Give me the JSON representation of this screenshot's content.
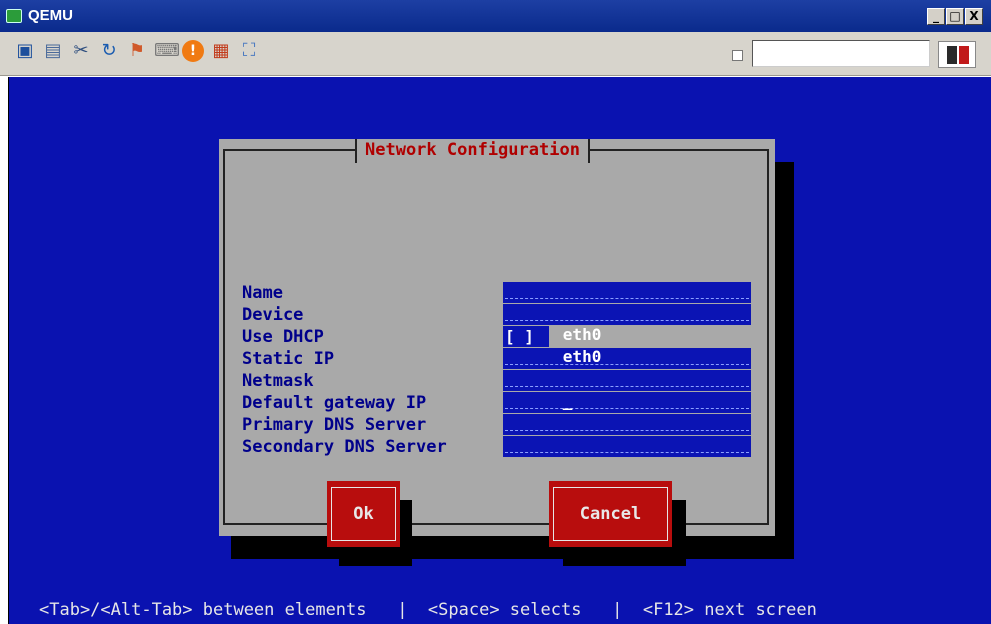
{
  "window": {
    "title": "QEMU",
    "controls": [
      "_",
      "□",
      "X"
    ]
  },
  "toolbar": {
    "icons": [
      "monitor-icon",
      "window-icon",
      "tools-icon",
      "refresh-icon",
      "windows-flag-icon",
      "keyboard-icon",
      "alert-icon",
      "network-icon",
      "fullscreen-icon"
    ],
    "input_value": "",
    "flag_colors": [
      "#2a2a2a",
      "#c11a1a"
    ]
  },
  "dialog": {
    "title": "Network Configuration",
    "fields": [
      {
        "label": "Name",
        "value": "eth0"
      },
      {
        "label": "Device",
        "value": "eth0"
      },
      {
        "label": "Use DHCP",
        "value": "[ ]"
      },
      {
        "label": "Static IP",
        "value": "_"
      },
      {
        "label": "Netmask",
        "value": ""
      },
      {
        "label": "Default gateway IP",
        "value": ""
      },
      {
        "label": "Primary DNS Server",
        "value": ""
      },
      {
        "label": "Secondary DNS Server",
        "value": ""
      }
    ],
    "ok_label": "Ok",
    "cancel_label": "Cancel"
  },
  "statusbar": {
    "text": "<Tab>/<Alt-Tab> between elements   |  <Space> selects   |  <F12> next screen"
  },
  "colors": {
    "screen_bg": "#0a12b0",
    "dialog_bg": "#a9a9a9",
    "title_red": "#b00000",
    "button_red": "#b80d0d",
    "label_blue": "#00008b"
  }
}
